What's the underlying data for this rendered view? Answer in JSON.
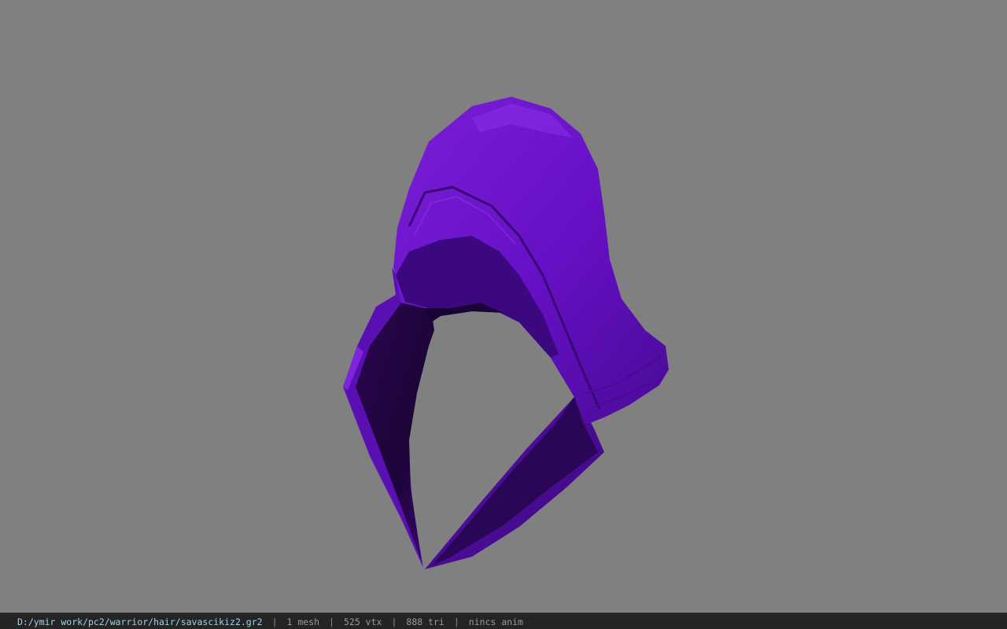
{
  "viewer": {
    "model": "purple-hood-mesh",
    "background_color": "#808080",
    "model_color": "#6a0fc0"
  },
  "statusbar": {
    "file_path": "D:/ymir work/pc2/warrior/hair/savascikiz2.gr2",
    "separator": "|",
    "mesh_count": "1 mesh",
    "vertex_count": "525 vtx",
    "triangle_count": "888 tri",
    "anim_status": "nincs anim"
  }
}
